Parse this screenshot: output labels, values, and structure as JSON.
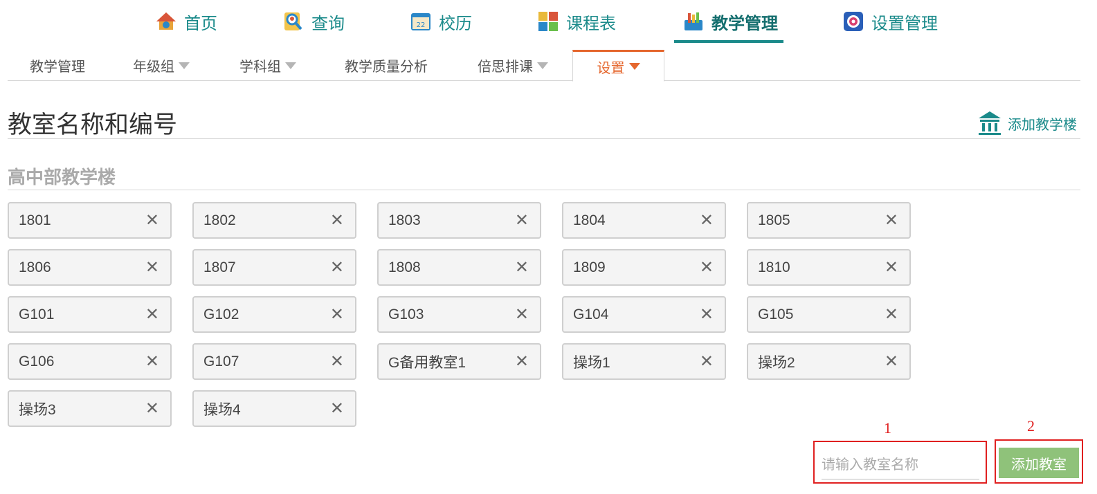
{
  "topnav": {
    "items": [
      {
        "label": "首页",
        "icon": "home-icon"
      },
      {
        "label": "查询",
        "icon": "search-person-icon"
      },
      {
        "label": "校历",
        "icon": "calendar-icon"
      },
      {
        "label": "课程表",
        "icon": "timetable-icon"
      },
      {
        "label": "教学管理",
        "icon": "teaching-management-icon",
        "active": true
      },
      {
        "label": "设置管理",
        "icon": "settings-icon"
      }
    ]
  },
  "subtabs": [
    {
      "label": "教学管理",
      "dropdown": false
    },
    {
      "label": "年级组",
      "dropdown": true
    },
    {
      "label": "学科组",
      "dropdown": true
    },
    {
      "label": "教学质量分析",
      "dropdown": false
    },
    {
      "label": "倍思排课",
      "dropdown": true
    },
    {
      "label": "设置",
      "dropdown": true,
      "active": true
    }
  ],
  "page": {
    "title": "教室名称和编号",
    "add_building_label": "添加教学楼",
    "section_title": "高中部教学楼"
  },
  "rooms": [
    "1801",
    "1802",
    "1803",
    "1804",
    "1805",
    "1806",
    "1807",
    "1808",
    "1809",
    "1810",
    "G101",
    "G102",
    "G103",
    "G104",
    "G105",
    "G106",
    "G107",
    "G备用教室1",
    "操场1",
    "操场2",
    "操场3",
    "操场4"
  ],
  "remove_symbol": "✕",
  "form": {
    "input_placeholder": "请输入教室名称",
    "input_value": "",
    "add_button_label": "添加教室",
    "marker_1": "1",
    "marker_2": "2"
  },
  "colors": {
    "accent": "#1a8a8a",
    "active_tab": "#e5672e",
    "add_button": "#8fc27a",
    "annotation": "#e02020"
  }
}
